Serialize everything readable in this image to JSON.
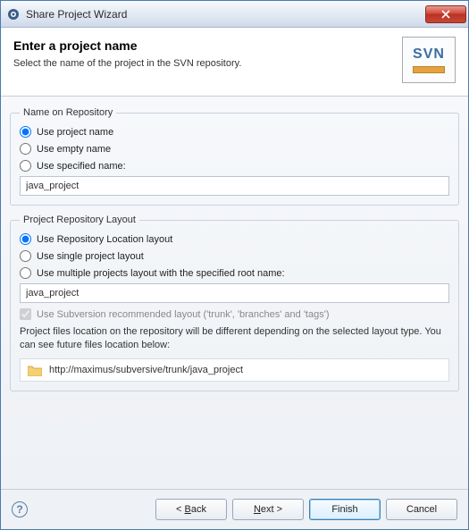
{
  "window": {
    "title": "Share Project Wizard"
  },
  "banner": {
    "heading": "Enter a project name",
    "sub": "Select the name of the project in the SVN repository.",
    "logo_text": "SVN"
  },
  "name_group": {
    "legend": "Name on Repository",
    "opt_project": "Use project name",
    "opt_empty": "Use empty name",
    "opt_specified": "Use specified name:",
    "specified_value": "java_project"
  },
  "layout_group": {
    "legend": "Project Repository Layout",
    "opt_location": "Use Repository Location layout",
    "opt_single": "Use single project layout",
    "opt_multiple": "Use multiple projects layout with the specified root name:",
    "root_value": "java_project",
    "recommended": "Use Subversion recommended layout ('trunk', 'branches' and 'tags')",
    "info": "Project files location on the repository will be different depending on the selected layout type. You can see future files location below:",
    "path": "http://maximus/subversive/trunk/java_project"
  },
  "footer": {
    "back": "< Back",
    "next": "Next >",
    "finish": "Finish",
    "cancel": "Cancel"
  }
}
